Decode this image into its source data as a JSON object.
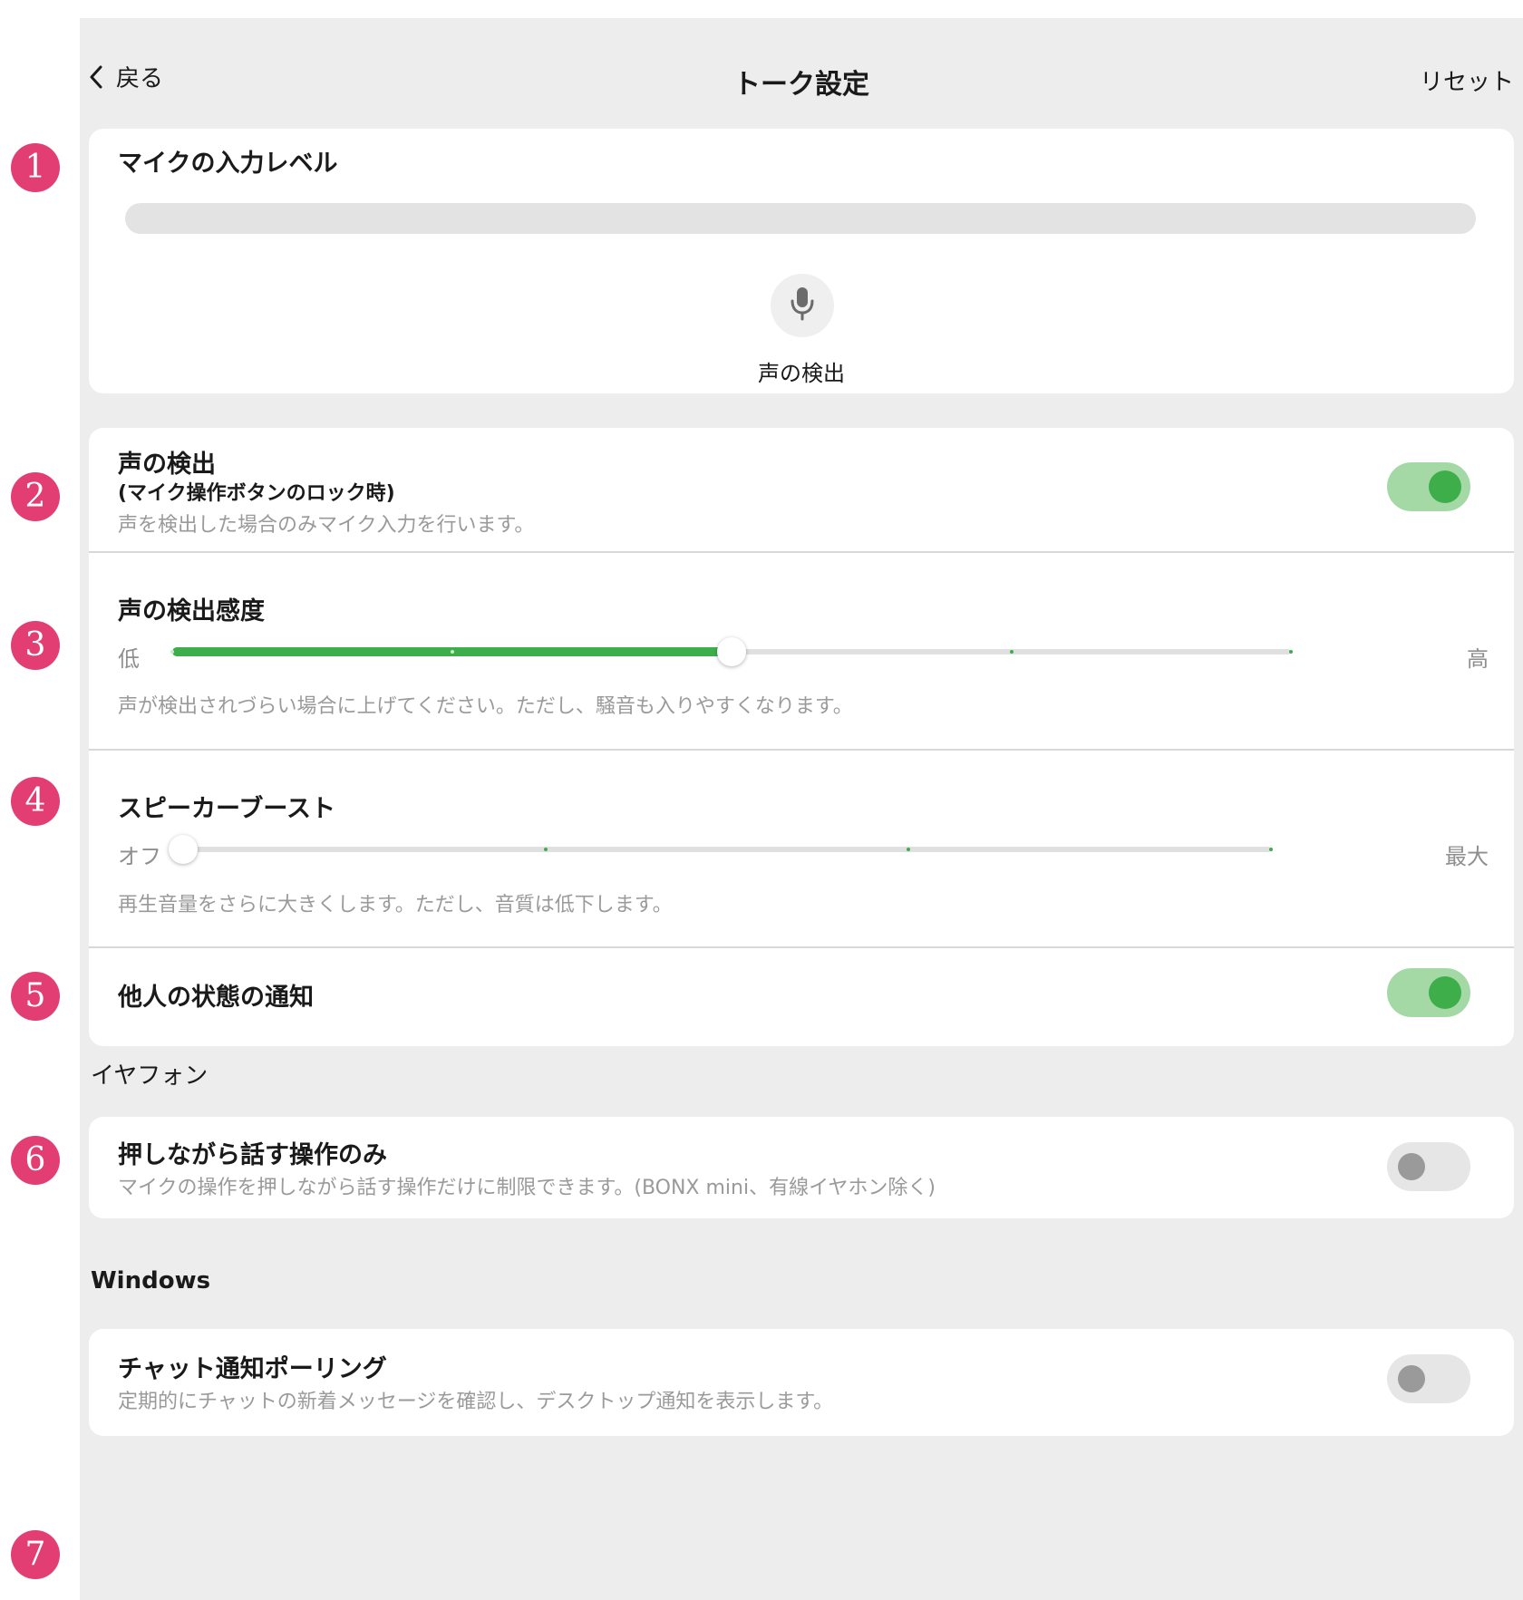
{
  "header": {
    "back_label": "戻る",
    "title": "トーク設定",
    "reset_label": "リセット"
  },
  "badges": [
    "1",
    "2",
    "3",
    "4",
    "5",
    "6",
    "7"
  ],
  "mic_level": {
    "title": "マイクの入力レベル",
    "level": 0,
    "mic_label": "声の検出"
  },
  "voice_detect": {
    "title": "声の検出",
    "subtitle": "(マイク操作ボタンのロック時)",
    "description": "声を検出した場合のみマイク入力を行います。",
    "enabled": true
  },
  "sensitivity": {
    "title": "声の検出感度",
    "min_label": "低",
    "max_label": "高",
    "value": 0.5,
    "steps": 4,
    "description": "声が検出されづらい場合に上げてください。ただし、騒音も入りやすくなります。"
  },
  "speaker_boost": {
    "title": "スピーカーブースト",
    "min_label": "オフ",
    "max_label": "最大",
    "value": 0,
    "steps": 3,
    "description": "再生音量をさらに大きくします。ただし、音質は低下します。"
  },
  "others_status": {
    "title": "他人の状態の通知",
    "enabled": true
  },
  "earphone_section": {
    "header": "イヤフォン",
    "ptt_only": {
      "title": "押しながら話す操作のみ",
      "description": "マイクの操作を押しながら話す操作だけに制限できます。(BONX mini、有線イヤホン除く)",
      "enabled": false
    }
  },
  "windows_section": {
    "header": "Windows",
    "chat_polling": {
      "title": "チャット通知ポーリング",
      "description": "定期的にチャットの新着メッセージを確認し、デスクトップ通知を表示します。",
      "enabled": false
    }
  },
  "colors": {
    "accent": "#3eae4b",
    "toggle_on_track": "#a4d9a6",
    "badge": "#e23e73",
    "background": "#ededed"
  }
}
